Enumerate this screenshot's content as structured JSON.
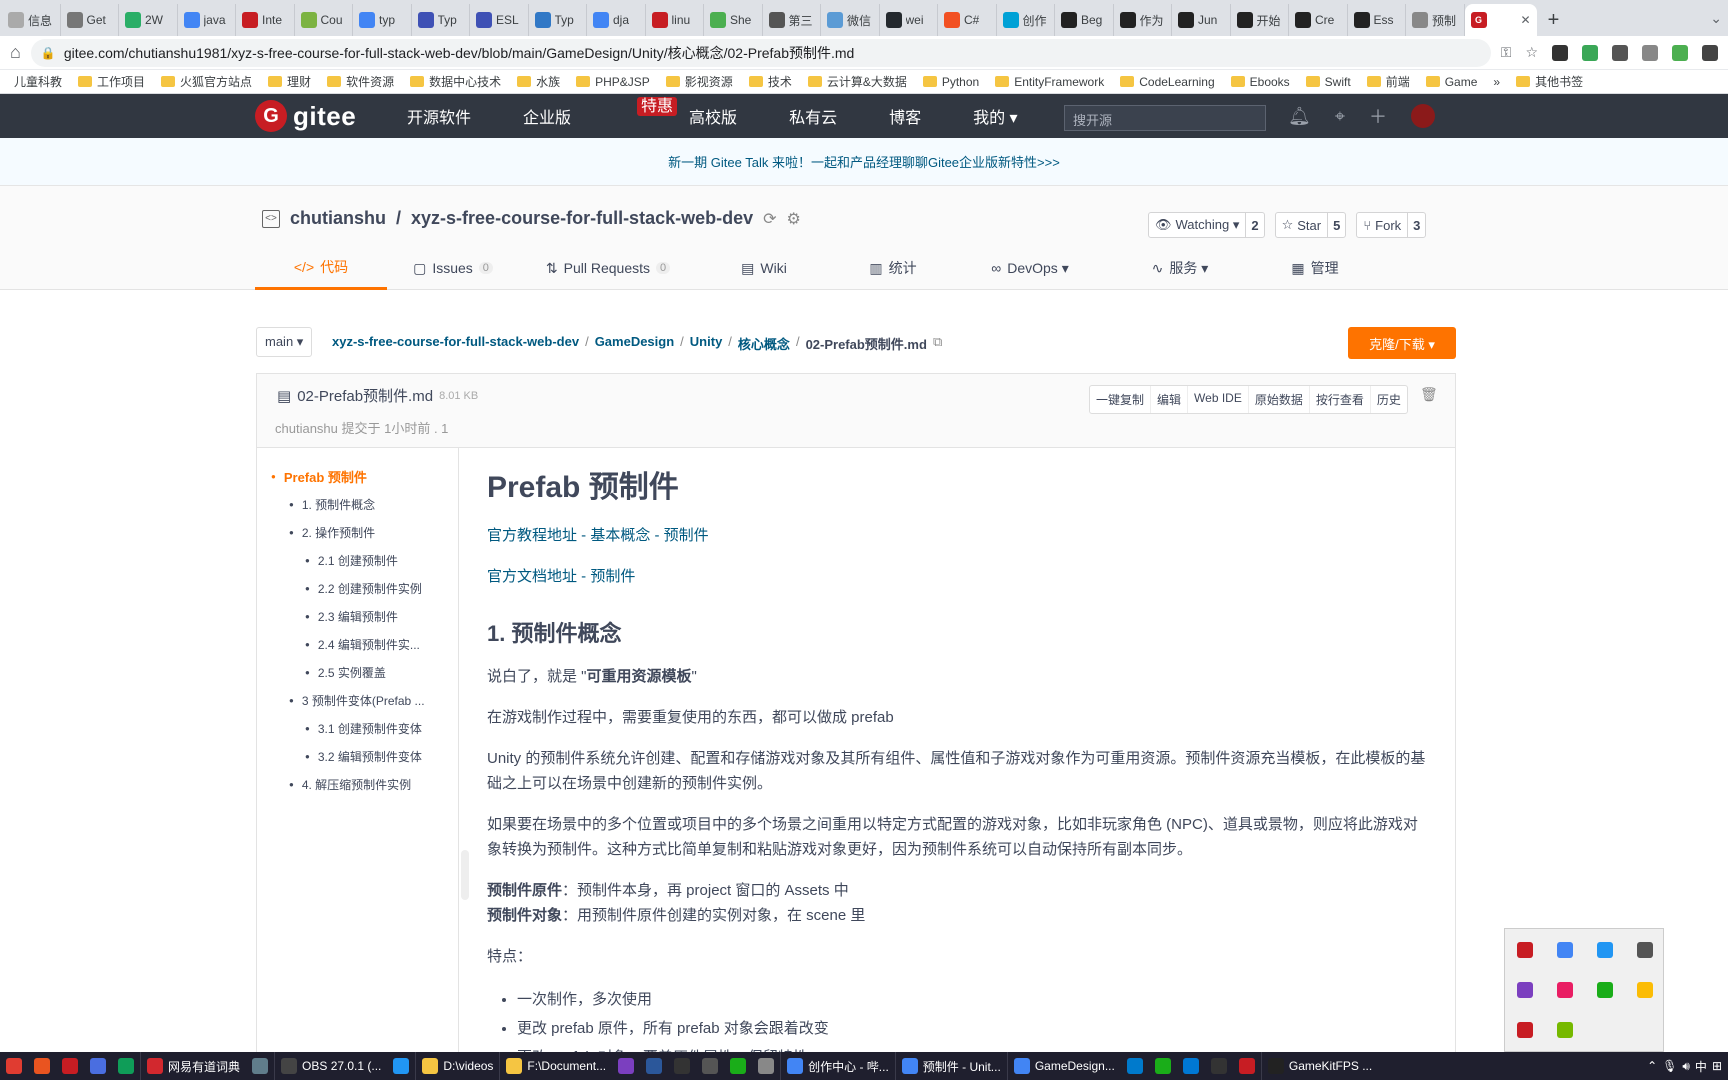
{
  "tabs": [
    {
      "label": "信息",
      "color": "#aaaaaa"
    },
    {
      "label": "Get",
      "color": "#777777"
    },
    {
      "label": "2W",
      "color": "#2aae67"
    },
    {
      "label": "java",
      "color": "#4285f4"
    },
    {
      "label": "Inte",
      "color": "#c71d23"
    },
    {
      "label": "Cou",
      "color": "#7cb342"
    },
    {
      "label": "typ",
      "color": "#4285f4"
    },
    {
      "label": "Typ",
      "color": "#3f51b5"
    },
    {
      "label": "ESL",
      "color": "#3f51b5"
    },
    {
      "label": "Typ",
      "color": "#3178c6"
    },
    {
      "label": "dja",
      "color": "#4285f4"
    },
    {
      "label": "linu",
      "color": "#c71d23"
    },
    {
      "label": "She",
      "color": "#4caf50"
    },
    {
      "label": "第三",
      "color": "#555555"
    },
    {
      "label": "微信",
      "color": "#5b9bd5"
    },
    {
      "label": "wei",
      "color": "#24292e"
    },
    {
      "label": "C#",
      "color": "#f25022"
    },
    {
      "label": "创作",
      "color": "#00a1d6"
    },
    {
      "label": "Beg",
      "color": "#222222"
    },
    {
      "label": "作为",
      "color": "#222222"
    },
    {
      "label": "Jun",
      "color": "#222222"
    },
    {
      "label": "开始",
      "color": "#222222"
    },
    {
      "label": "Cre",
      "color": "#222222"
    },
    {
      "label": "Ess",
      "color": "#222222"
    },
    {
      "label": "预制",
      "color": "#888888"
    }
  ],
  "active_tab": {
    "label": "G",
    "color": "#c71d23"
  },
  "address_bar": {
    "url": "gitee.com/chutianshu1981/xyz-s-free-course-for-full-stack-web-dev/blob/main/GameDesign/Unity/核心概念/02-Prefab预制件.md"
  },
  "bookmarks": [
    "儿童科教",
    "工作项目",
    "火狐官方站点",
    "理财",
    "软件资源",
    "数据中心技术",
    "水族",
    "PHP&JSP",
    "影视资源",
    "技术",
    "云计算&大数据",
    "Python",
    "EntityFramework",
    "CodeLearning",
    "Ebooks",
    "Swift",
    "前端",
    "Game"
  ],
  "bookmarks_more": "»",
  "bookmarks_other": "其他书签",
  "gitee_nav": {
    "logo_letter": "G",
    "logo_text": "gitee",
    "menu": [
      "开源软件",
      "企业版",
      "高校版",
      "私有云",
      "博客",
      "我的 ▾"
    ],
    "hot_badge": "特惠",
    "search_placeholder": "搜开源"
  },
  "banner": {
    "text": "新一期 Gitee Talk 来啦！一起和产品经理聊聊Gitee企业版新特性>>>"
  },
  "repo": {
    "owner": "chutianshu",
    "sep": "/",
    "name": "xyz-s-free-course-for-full-stack-web-dev",
    "watching_label": "Watching ▾",
    "watching_count": "2",
    "star_label": "Star",
    "star_count": "5",
    "fork_label": "Fork",
    "fork_count": "3"
  },
  "repo_tabs": [
    {
      "label": "代码",
      "icon": "</>",
      "count": ""
    },
    {
      "label": "Issues",
      "icon": "▢",
      "count": "0"
    },
    {
      "label": "Pull Requests",
      "icon": "⇅",
      "count": "0"
    },
    {
      "label": "Wiki",
      "icon": "▤",
      "count": ""
    },
    {
      "label": "统计",
      "icon": "▥",
      "count": ""
    },
    {
      "label": "DevOps ▾",
      "icon": "∞",
      "count": ""
    },
    {
      "label": "服务 ▾",
      "icon": "∿",
      "count": ""
    },
    {
      "label": "管理",
      "icon": "▦",
      "count": ""
    }
  ],
  "path": {
    "branch": "main ▾",
    "crumbs": [
      "xyz-s-free-course-for-full-stack-web-dev",
      "GameDesign",
      "Unity",
      "核心概念"
    ],
    "current": "02-Prefab预制件.md",
    "clone_label": "克隆/下载 ▾"
  },
  "file": {
    "name": "02-Prefab预制件.md",
    "size": "8.01 KB",
    "commit": "chutianshu 提交于 1小时前 . 1",
    "actions": [
      "一键复制",
      "编辑",
      "Web IDE",
      "原始数据",
      "按行查看",
      "历史"
    ]
  },
  "toc": [
    {
      "level": 0,
      "label": "Prefab 预制件"
    },
    {
      "level": 1,
      "label": "1. 预制件概念"
    },
    {
      "level": 1,
      "label": "2. 操作预制件"
    },
    {
      "level": 2,
      "label": "2.1 创建预制件"
    },
    {
      "level": 2,
      "label": "2.2 创建预制件实例"
    },
    {
      "level": 2,
      "label": "2.3 编辑预制件"
    },
    {
      "level": 2,
      "label": "2.4 编辑预制件实..."
    },
    {
      "level": 2,
      "label": "2.5 实例覆盖"
    },
    {
      "level": 1,
      "label": "3 预制件变体(Prefab ..."
    },
    {
      "level": 2,
      "label": "3.1 创建预制件变体"
    },
    {
      "level": 2,
      "label": "3.2 编辑预制件变体"
    },
    {
      "level": 1,
      "label": "4. 解压缩预制件实例"
    }
  ],
  "doc": {
    "title": "Prefab 预制件",
    "link1": "官方教程地址 - 基本概念 - 预制件",
    "link2": "官方文档地址 - 预制件",
    "h2": "1. 预制件概念",
    "p1_pre": "说白了，就是 \"",
    "p1_bold": "可重用资源模板",
    "p1_post": "\"",
    "p2": "在游戏制作过程中，需要重复使用的东西，都可以做成 prefab",
    "p3": "Unity 的预制件系统允许创建、配置和存储游戏对象及其所有组件、属性值和子游戏对象作为可重用资源。预制件资源充当模板，在此模板的基础之上可以在场景中创建新的预制件实例。",
    "p4": "如果要在场景中的多个位置或项目中的多个场景之间重用以特定方式配置的游戏对象，比如非玩家角色 (NPC)、道具或景物，则应将此游戏对象转换为预制件。这种方式比简单复制和粘贴游戏对象更好，因为预制件系统可以自动保持所有副本同步。",
    "def1_term": "预制件原件",
    "def1_text": "：预制件本身，再 project 窗口的 Assets 中",
    "def2_term": "预制件对象",
    "def2_text": "：用预制件原件创建的实例对象，在 scene 里",
    "features_label": "特点：",
    "features": [
      "一次制作，多次使用",
      "更改 prefab 原件，所有 prefab 对象会跟着改变",
      "更改 prefab 对象，覆盖原件属性，保留特性"
    ]
  },
  "taskbar": [
    {
      "label": "",
      "color": "#e03c31"
    },
    {
      "label": "",
      "color": "#e95420"
    },
    {
      "label": "",
      "color": "#c71d23"
    },
    {
      "label": "",
      "color": "#4a6ee0"
    },
    {
      "label": "",
      "color": "#0f9d58"
    },
    {
      "label": "网易有道词典",
      "color": "#d2282e"
    },
    {
      "label": "",
      "color": "#607d8b"
    },
    {
      "label": "OBS 27.0.1 (...",
      "color": "#444444"
    },
    {
      "label": "",
      "color": "#2196f3"
    },
    {
      "label": "D:\\videos",
      "color": "#f5c542"
    },
    {
      "label": "F:\\Document...",
      "color": "#f5c542"
    },
    {
      "label": "",
      "color": "#7b3fbf"
    },
    {
      "label": "",
      "color": "#2b579a"
    },
    {
      "label": "",
      "color": "#333333"
    },
    {
      "label": "",
      "color": "#555555"
    },
    {
      "label": "",
      "color": "#1aad19"
    },
    {
      "label": "",
      "color": "#888888"
    },
    {
      "label": "创作中心 - 哔...",
      "color": "#4285f4"
    },
    {
      "label": "预制件 - Unit...",
      "color": "#4285f4"
    },
    {
      "label": "GameDesign...",
      "color": "#4285f4"
    },
    {
      "label": "",
      "color": "#007acc"
    },
    {
      "label": "",
      "color": "#1aad19"
    },
    {
      "label": "",
      "color": "#0078d4"
    },
    {
      "label": "",
      "color": "#333333"
    },
    {
      "label": "",
      "color": "#c71d23"
    },
    {
      "label": "GameKitFPS ...",
      "color": "#222222"
    }
  ],
  "systray": {
    "ime": "中",
    "time_hint": "⊞"
  },
  "tray_icons": [
    "#c71d23",
    "#4285f4",
    "#2196f3",
    "#555555",
    "#7b3fbf",
    "#e91e63",
    "#1aad19",
    "#fbbc05",
    "#c71d23",
    "#76b900"
  ]
}
